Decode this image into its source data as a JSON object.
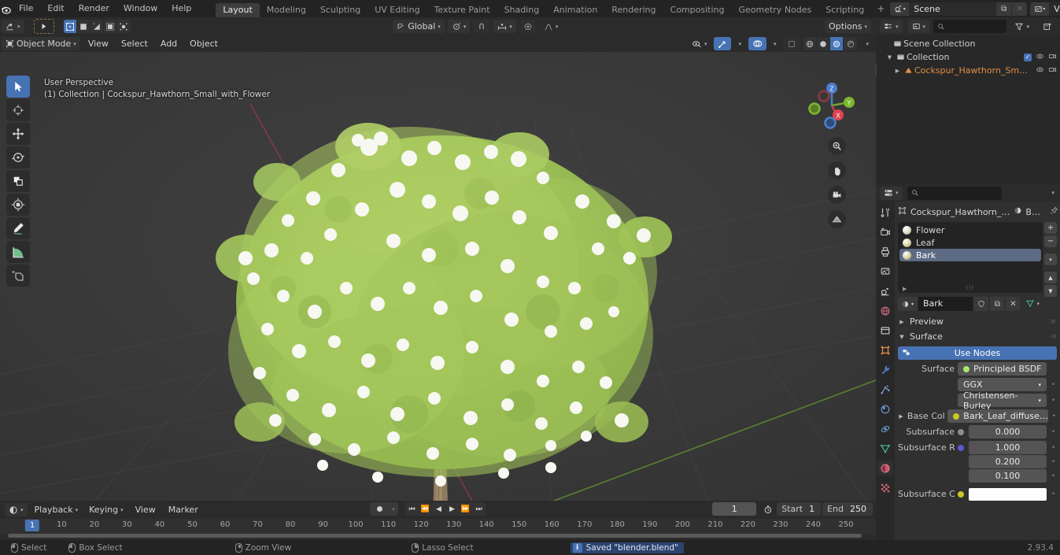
{
  "app": {
    "version": "2.93.4",
    "logo_icon": "blender-logo"
  },
  "topbar": {
    "menus": [
      "File",
      "Edit",
      "Render",
      "Window",
      "Help"
    ],
    "workspaces": [
      {
        "label": "Layout",
        "active": true
      },
      {
        "label": "Modeling",
        "active": false
      },
      {
        "label": "Sculpting",
        "active": false
      },
      {
        "label": "UV Editing",
        "active": false
      },
      {
        "label": "Texture Paint",
        "active": false
      },
      {
        "label": "Shading",
        "active": false
      },
      {
        "label": "Animation",
        "active": false
      },
      {
        "label": "Rendering",
        "active": false
      },
      {
        "label": "Compositing",
        "active": false
      },
      {
        "label": "Geometry Nodes",
        "active": false
      },
      {
        "label": "Scripting",
        "active": false
      }
    ],
    "add_workspace_label": "+",
    "scene": {
      "name": "Scene",
      "icon": "scene-icon",
      "new_icon": "copy-icon",
      "unlink_icon": "x-icon"
    },
    "view_layer": {
      "name": "View Layer",
      "icon": "viewlayer-icon",
      "new_icon": "copy-icon",
      "unlink_icon": "x-icon"
    }
  },
  "editor_row": {
    "editor_type_icon": "editor-type-icon",
    "play_icon": "play-icon",
    "mode_icons": [
      "uv-verts-icon",
      "uv-face-icon",
      "uv-corner-icon",
      "uv-island-icon",
      "uv-sync-icon"
    ]
  },
  "viewport_header": {
    "transform_orientation": "Global",
    "orientation_icon": "orientation-icon",
    "pivot_icon": "pivot-icon",
    "snap_icon": "magnet-icon",
    "snap_mode_icon": "snap-increment-icon",
    "proportional_icon": "proportional-edit-icon",
    "falloff_icon": "falloff-curve-icon",
    "options_label": "Options",
    "mode": "Object Mode",
    "mode_icon": "object-mode-icon",
    "menus": [
      "View",
      "Select",
      "Add",
      "Object"
    ],
    "visibility_icon": "visibility-icon",
    "gizmo_icon": "gizmo-icon",
    "overlays_icon": "overlays-icon",
    "xray_icon": "xray-icon",
    "shading_modes": [
      {
        "icon": "wireframe-icon",
        "active": false
      },
      {
        "icon": "solid-icon",
        "active": false
      },
      {
        "icon": "material-preview-icon",
        "active": true
      },
      {
        "icon": "rendered-icon",
        "active": false
      }
    ]
  },
  "viewport": {
    "perspective_label": "User Perspective",
    "context_label": "(1) Collection | Cockspur_Hawthorn_Small_with_Flower",
    "tools": [
      {
        "name": "tweak-tool",
        "icon": "cursor-arrow-icon",
        "active": true
      },
      {
        "name": "cursor-tool",
        "icon": "3d-cursor-icon",
        "active": false
      },
      {
        "name": "move-tool",
        "icon": "move-icon",
        "active": false
      },
      {
        "name": "rotate-tool",
        "icon": "rotate-icon",
        "active": false
      },
      {
        "name": "scale-tool",
        "icon": "scale-icon",
        "active": false
      },
      {
        "name": "transform-tool",
        "icon": "transform-icon",
        "active": false
      },
      {
        "name": "annotate-tool",
        "icon": "pencil-icon",
        "active": false
      },
      {
        "name": "measure-tool",
        "icon": "ruler-icon",
        "active": false
      },
      {
        "name": "add-cube-tool",
        "icon": "add-cube-icon",
        "active": false
      }
    ],
    "gizmo_axes": [
      "X",
      "Y",
      "Z"
    ],
    "nav_buttons": [
      {
        "name": "zoom-view",
        "icon": "zoom-icon"
      },
      {
        "name": "pan-view",
        "icon": "hand-icon"
      },
      {
        "name": "camera-view",
        "icon": "camera-icon"
      },
      {
        "name": "toggle-ortho",
        "icon": "grid-icon"
      }
    ]
  },
  "outliner": {
    "display_mode_icon": "outliner-display-icon",
    "filter_id_icon": "id-type-icon",
    "search_placeholder": "",
    "search_value": "",
    "filter_icon": "funnel-icon",
    "new_collection_icon": "new-collection-icon",
    "rows": [
      {
        "label": "Scene Collection",
        "depth": 0,
        "icon": "collection-icon",
        "expand": "",
        "checkbox": false,
        "eye": false,
        "camera": false,
        "selected": false
      },
      {
        "label": "Collection",
        "depth": 1,
        "icon": "collection-icon",
        "expand": "▼",
        "checkbox": true,
        "eye": true,
        "camera": true,
        "selected": false
      },
      {
        "label": "Cockspur_Hawthorn_Sm…",
        "depth": 2,
        "icon": "mesh-object-icon",
        "expand": "▶",
        "checkbox": false,
        "eye": true,
        "camera": true,
        "selected": false
      }
    ]
  },
  "properties": {
    "editor_icon": "properties-editor-icon",
    "search_placeholder": "",
    "breadcrumb": {
      "object_icon": "object-icon",
      "object_name": "Cockspur_Hawthorn_…",
      "material_icon": "material-icon",
      "material_name": "B…",
      "pin_icon": "pin-icon"
    },
    "tabs": [
      {
        "name": "tool-tab",
        "icon": "tool-icon",
        "active": false
      },
      {
        "name": "render-tab",
        "icon": "render-icon",
        "active": false
      },
      {
        "name": "output-tab",
        "icon": "printer-icon",
        "active": false
      },
      {
        "name": "view-layer-tab",
        "icon": "images-icon",
        "active": false
      },
      {
        "name": "scene-tab",
        "icon": "scene-cone-icon",
        "active": false
      },
      {
        "name": "world-tab",
        "icon": "world-icon",
        "active": false
      },
      {
        "name": "collection-tab",
        "icon": "collection-box-icon",
        "active": false
      },
      {
        "name": "object-tab",
        "icon": "object-square-icon",
        "active": false
      },
      {
        "name": "modifier-tab",
        "icon": "wrench-icon",
        "active": false
      },
      {
        "name": "particles-tab",
        "icon": "particles-icon",
        "active": false
      },
      {
        "name": "physics-tab",
        "icon": "physics-icon",
        "active": false
      },
      {
        "name": "constraints-tab",
        "icon": "constraint-icon",
        "active": false
      },
      {
        "name": "data-tab",
        "icon": "mesh-data-icon",
        "active": false
      },
      {
        "name": "material-tab",
        "icon": "material-ball-icon",
        "active": true
      },
      {
        "name": "texture-tab",
        "icon": "checker-texture-icon",
        "active": false
      }
    ],
    "material_slots": [
      {
        "name": "Flower",
        "color": "#ded9c8",
        "selected": false
      },
      {
        "name": "Leaf",
        "color": "#d8cf9c",
        "selected": false
      },
      {
        "name": "Bark",
        "color": "#d6cc9e",
        "selected": true
      }
    ],
    "slot_add_label": "+",
    "slot_remove_label": "−",
    "slot_menu_icon": "chevron-down-icon",
    "slot_up_icon": "arrow-up-icon",
    "slot_down_icon": "arrow-down-icon",
    "material_field": {
      "browse_icon": "material-browse-icon",
      "name": "Bark",
      "fake_user_icon": "shield-icon",
      "new_icon": "copy-icon",
      "unlink_icon": "x-icon",
      "nodes_icon": "node-tree-icon"
    },
    "panels": [
      {
        "label": "Preview",
        "expanded": false
      },
      {
        "label": "Surface",
        "expanded": true
      }
    ],
    "use_nodes_label": "Use Nodes",
    "use_nodes_icon": "nodes-icon",
    "rows": [
      {
        "label": "Surface",
        "value": "Principled BSDF",
        "type": "node-select",
        "socket": "#a7e86a"
      },
      {
        "label": "",
        "value": "GGX",
        "type": "dropdown"
      },
      {
        "label": "",
        "value": "Christensen-Burley",
        "type": "dropdown"
      },
      {
        "label": "Base Color",
        "value": "Bark_Leaf_diffuse…",
        "type": "link",
        "socket": "#ccc822",
        "expand": "▶"
      },
      {
        "label": "Subsurface",
        "value": "0.000",
        "type": "slider",
        "socket": "#8d8d8d"
      },
      {
        "label": "Subsurface Ra…",
        "value": "1.000",
        "type": "slider",
        "socket": "#5a5ad4"
      },
      {
        "label": "",
        "value": "0.200",
        "type": "slider"
      },
      {
        "label": "",
        "value": "0.100",
        "type": "slider"
      },
      {
        "label": "Subsurface Col…",
        "value": "",
        "type": "color",
        "socket": "#ccc822",
        "color": "#fdfdfd"
      }
    ]
  },
  "timeline": {
    "editor_icon": "timeline-editor-icon",
    "menus": [
      "Playback",
      "Keying",
      "View",
      "Marker"
    ],
    "record_icon": "record-icon",
    "transport": [
      {
        "name": "jump-to-start",
        "icon": "jump-start-icon"
      },
      {
        "name": "prev-keyframe",
        "icon": "prev-key-icon"
      },
      {
        "name": "play-reverse",
        "icon": "play-reverse-icon"
      },
      {
        "name": "play",
        "icon": "play-icon"
      },
      {
        "name": "next-keyframe",
        "icon": "next-key-icon"
      },
      {
        "name": "jump-to-end",
        "icon": "jump-end-icon"
      }
    ],
    "current_frame": "1",
    "auto_key_icon": "stopwatch-icon",
    "start_label": "Start",
    "start_value": "1",
    "end_label": "End",
    "end_value": "250",
    "playhead_frame": "1",
    "ticks": [
      10,
      20,
      30,
      40,
      50,
      60,
      70,
      80,
      90,
      100,
      110,
      120,
      130,
      140,
      150,
      160,
      170,
      180,
      190,
      200,
      210,
      220,
      230,
      240,
      250
    ]
  },
  "statusbar": {
    "hints": [
      {
        "label": "Select",
        "icon": "mouse-left-icon"
      },
      {
        "label": "Box Select",
        "icon": "mouse-left-drag-icon"
      },
      {
        "label": "Zoom View",
        "icon": "mouse-middle-icon"
      },
      {
        "label": "Lasso Select",
        "icon": "mouse-right-icon"
      }
    ],
    "report": "Saved \"blender.blend\"",
    "report_icon": "info-icon",
    "version": "2.93.4"
  }
}
